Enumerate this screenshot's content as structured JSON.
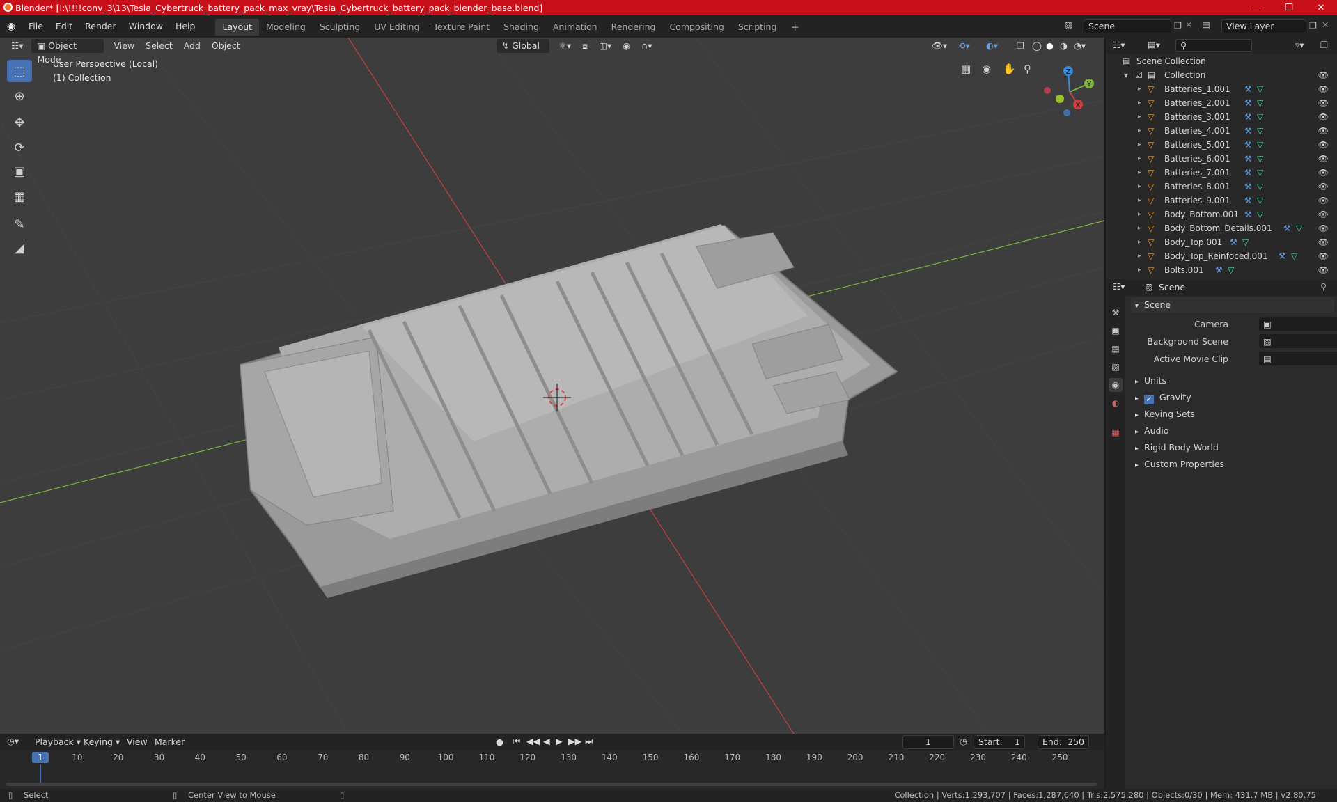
{
  "window": {
    "title": "Blender* [I:\\!!!!conv_3\\13\\Tesla_Cybertruck_battery_pack_max_vray\\Tesla_Cybertruck_battery_pack_blender_base.blend]"
  },
  "menu": {
    "items": [
      "File",
      "Edit",
      "Render",
      "Window",
      "Help"
    ]
  },
  "workspaces": [
    "Layout",
    "Modeling",
    "Sculpting",
    "UV Editing",
    "Texture Paint",
    "Shading",
    "Animation",
    "Rendering",
    "Compositing",
    "Scripting"
  ],
  "scene_field": "Scene",
  "view_layer_field": "View Layer",
  "viewport": {
    "mode": "Object Mode",
    "menus": [
      "View",
      "Select",
      "Add",
      "Object"
    ],
    "transform": "Global",
    "overlay_line1": "User Perspective (Local)",
    "overlay_line2": "(1) Collection",
    "axes": {
      "x": "X",
      "y": "Y",
      "z": "Z"
    }
  },
  "outliner": {
    "root": "Scene Collection",
    "collection": "Collection",
    "items": [
      "Batteries_1.001",
      "Batteries_2.001",
      "Batteries_3.001",
      "Batteries_4.001",
      "Batteries_5.001",
      "Batteries_6.001",
      "Batteries_7.001",
      "Batteries_8.001",
      "Batteries_9.001",
      "Body_Bottom.001",
      "Body_Bottom_Details.001",
      "Body_Top.001",
      "Body_Top_Reinfoced.001",
      "Bolts.001"
    ]
  },
  "properties": {
    "context": "Scene",
    "panel": "Scene",
    "camera_label": "Camera",
    "background_label": "Background Scene",
    "movie_clip_label": "Active Movie Clip",
    "sections": [
      "Units",
      "Gravity",
      "Keying Sets",
      "Audio",
      "Rigid Body World",
      "Custom Properties"
    ]
  },
  "timeline": {
    "menus": [
      "Playback",
      "Keying",
      "View",
      "Marker"
    ],
    "current_frame": "1",
    "start_label": "Start:",
    "start": "1",
    "end_label": "End:",
    "end": "250",
    "ruler": [
      "1",
      "10",
      "20",
      "30",
      "40",
      "50",
      "60",
      "70",
      "80",
      "90",
      "100",
      "110",
      "120",
      "130",
      "140",
      "150",
      "160",
      "170",
      "180",
      "190",
      "200",
      "210",
      "220",
      "230",
      "240",
      "250"
    ]
  },
  "status": {
    "left1": "Select",
    "left2": "Center View to Mouse",
    "right": "Collection | Verts:1,293,707 | Faces:1,287,640 | Tris:2,575,280 | Objects:0/30 | Mem: 431.7 MB | v2.80.75"
  },
  "colors": {
    "title_bar": "#c8101b",
    "accent": "#4772b3",
    "x_axis": "#c64040",
    "y_axis": "#7cb342",
    "z_axis": "#3b8ad8"
  }
}
